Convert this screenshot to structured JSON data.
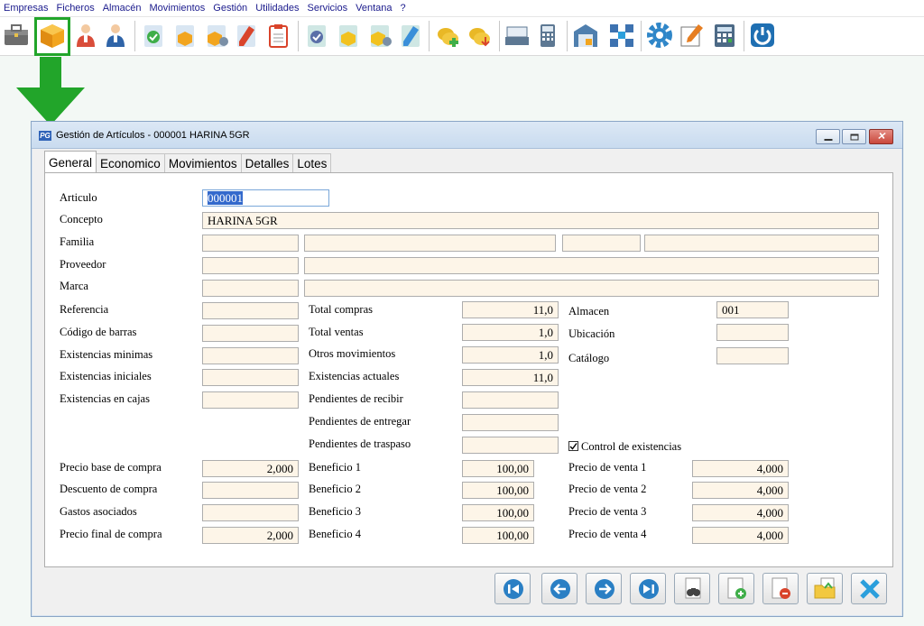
{
  "menu": [
    "Empresas",
    "Ficheros",
    "Almacén",
    "Movimientos",
    "Gestión",
    "Utilidades",
    "Servicios",
    "Ventana",
    "?"
  ],
  "window": {
    "title": "Gestión de Artículos - 000001 HARINA 5GR",
    "logo": "PG"
  },
  "tabs": [
    "General",
    "Economico",
    "Movimientos",
    "Detalles",
    "Lotes"
  ],
  "labels": {
    "articulo": "Articulo",
    "concepto": "Concepto",
    "familia": "Familia",
    "proveedor": "Proveedor",
    "marca": "Marca",
    "referencia": "Referencia",
    "codigo_barras": "Código de barras",
    "existencias_minimas": "Existencias minimas",
    "existencias_iniciales": "Existencias iniciales",
    "existencias_cajas": "Existencias en cajas",
    "total_compras": "Total compras",
    "total_ventas": "Total ventas",
    "otros_movimientos": "Otros movimientos",
    "existencias_actuales": "Existencias actuales",
    "pendientes_recibir": "Pendientes de recibir",
    "pendientes_entregar": "Pendientes de entregar",
    "pendientes_traspaso": "Pendientes de traspaso",
    "almacen": "Almacen",
    "ubicacion": "Ubicación",
    "catalogo": "Catálogo",
    "control_existencias": "Control de existencias",
    "precio_base_compra": "Precio base de compra",
    "descuento_compra": "Descuento de compra",
    "gastos_asociados": "Gastos asociados",
    "precio_final_compra": "Precio final de compra",
    "beneficio_1": "Beneficio 1",
    "beneficio_2": "Beneficio 2",
    "beneficio_3": "Beneficio 3",
    "beneficio_4": "Beneficio 4",
    "precio_venta_1": "Precio de venta 1",
    "precio_venta_2": "Precio de venta 2",
    "precio_venta_3": "Precio de venta 3",
    "precio_venta_4": "Precio de venta 4"
  },
  "values": {
    "articulo": "000001",
    "concepto": "HARINA 5GR",
    "total_compras": "11,0",
    "total_ventas": "1,0",
    "otros_movimientos": "1,0",
    "existencias_actuales": "11,0",
    "almacen": "001",
    "control_existencias_checked": true,
    "precio_base_compra": "2,000",
    "precio_final_compra": "2,000",
    "beneficio_1": "100,00",
    "beneficio_2": "100,00",
    "beneficio_3": "100,00",
    "beneficio_4": "100,00",
    "precio_venta_1": "4,000",
    "precio_venta_2": "4,000",
    "precio_venta_3": "4,000",
    "precio_venta_4": "4,000"
  },
  "colors": {
    "highlight_frame": "#22a52a",
    "arrow": "#22a52a",
    "field_bg": "#fdf5e8",
    "selection": "#3369cc",
    "nav_icon": "#2a7fc4"
  }
}
